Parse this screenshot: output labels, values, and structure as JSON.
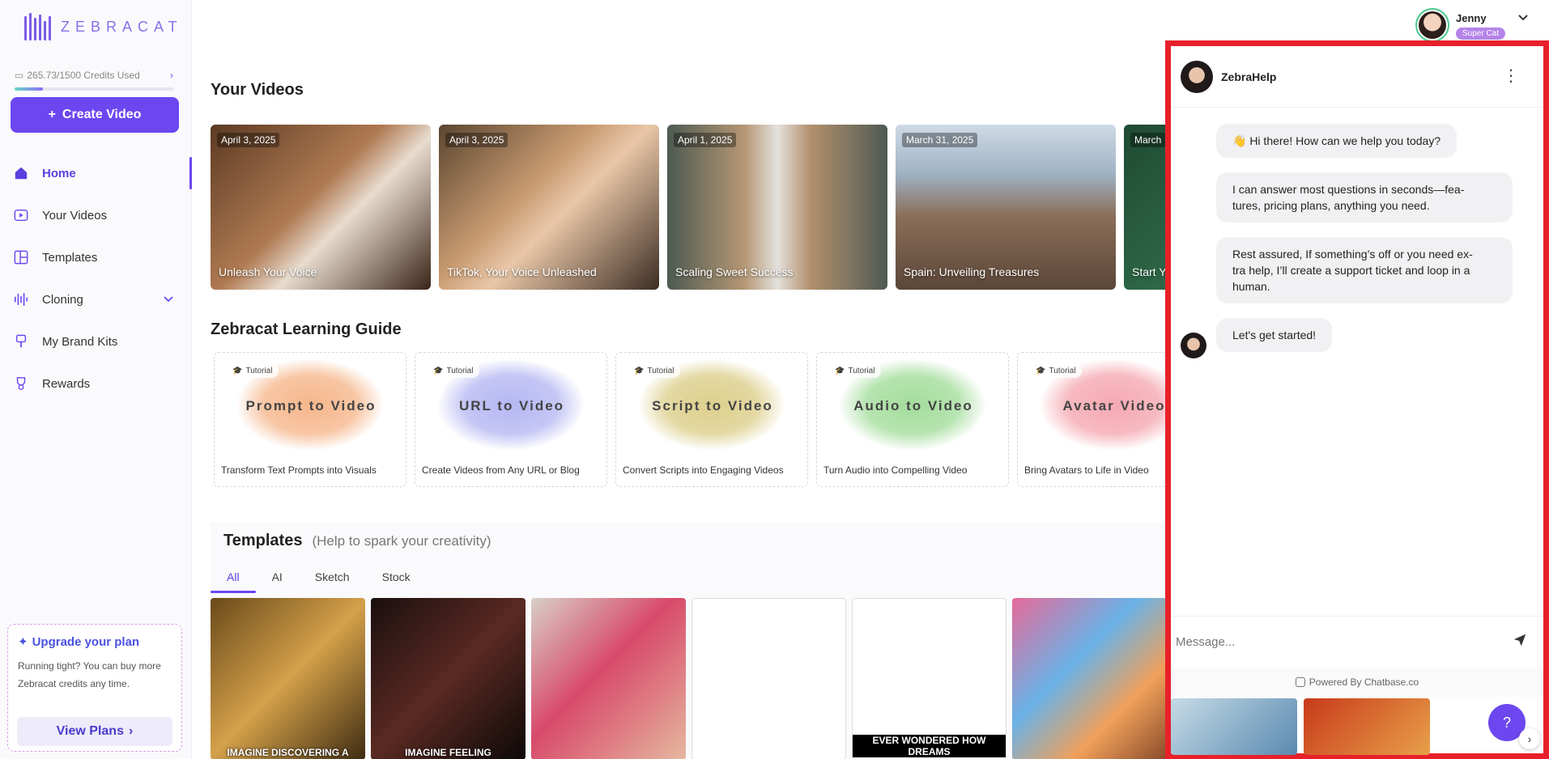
{
  "brand": {
    "name": "ZEBRACAT",
    "accent": "#6c47f0"
  },
  "credits": {
    "text": "265.73/1500 Credits Used",
    "used": 265.73,
    "total": 1500
  },
  "create_button": {
    "label": "Create Video"
  },
  "nav": [
    {
      "label": "Home",
      "icon": "home-icon",
      "active": true
    },
    {
      "label": "Your Videos",
      "icon": "video-icon"
    },
    {
      "label": "Templates",
      "icon": "templates-icon"
    },
    {
      "label": "Cloning",
      "icon": "waveform-icon",
      "has_dropdown": true
    },
    {
      "label": "My Brand Kits",
      "icon": "brush-icon"
    },
    {
      "label": "Rewards",
      "icon": "trophy-icon"
    }
  ],
  "upgrade": {
    "title": "Upgrade your plan",
    "desc_line1": "Running tight? You can buy more",
    "desc_line2": "Zebracat credits any time.",
    "button": "View Plans"
  },
  "user": {
    "name": "Jenny",
    "badge": "Super Cat"
  },
  "videos": {
    "title": "Your Videos",
    "items": [
      {
        "date": "April 3, 2025",
        "title": "Unleash Your Voice"
      },
      {
        "date": "April 3, 2025",
        "title": "TikTok, Your Voice Unleashed"
      },
      {
        "date": "April 1, 2025",
        "title": "Scaling Sweet Success"
      },
      {
        "date": "March 31, 2025",
        "title": "Spain: Unveiling Treasures"
      },
      {
        "date": "March",
        "title": "Start Y"
      }
    ]
  },
  "guide": {
    "title": "Zebracat Learning Guide",
    "badge": "Tutorial",
    "items": [
      {
        "label": "Prompt to Video",
        "desc": "Transform Text Prompts into Visuals",
        "color": "#f6b78c"
      },
      {
        "label": "URL to Video",
        "desc": "Create Videos from Any URL or Blog",
        "color": "#b6b7f3"
      },
      {
        "label": "Script to Video",
        "desc": "Convert Scripts into Engaging Videos",
        "color": "#ddcf8c"
      },
      {
        "label": "Audio to Video",
        "desc": "Turn Audio into Compelling Video",
        "color": "#a4dd9c"
      },
      {
        "label": "Avatar Video",
        "desc": "Bring Avatars to Life in Video",
        "color": "#f5a8b2"
      }
    ]
  },
  "templates": {
    "title": "Templates",
    "subtitle": "(Help to spark your creativity)",
    "tabs": [
      "All",
      "AI",
      "Sketch",
      "Stock"
    ],
    "captions": [
      "IMAGINE DISCOVERING A",
      "IMAGINE FEELING",
      "",
      "",
      "EVER WONDERED HOW DREAMS",
      ""
    ]
  },
  "chat": {
    "title": "ZebraHelp",
    "messages": [
      "👋 Hi there! How can we help you today?",
      "I can answer most questions in seconds—fea-|tures, pricing plans, anything you need.",
      "Rest assured, If something’s off or you need ex-|tra help, I’ll create a support ticket and loop in a|human.",
      "Let's get started!"
    ],
    "input_placeholder": "Message...",
    "powered": "Powered By Chatbase.co"
  }
}
